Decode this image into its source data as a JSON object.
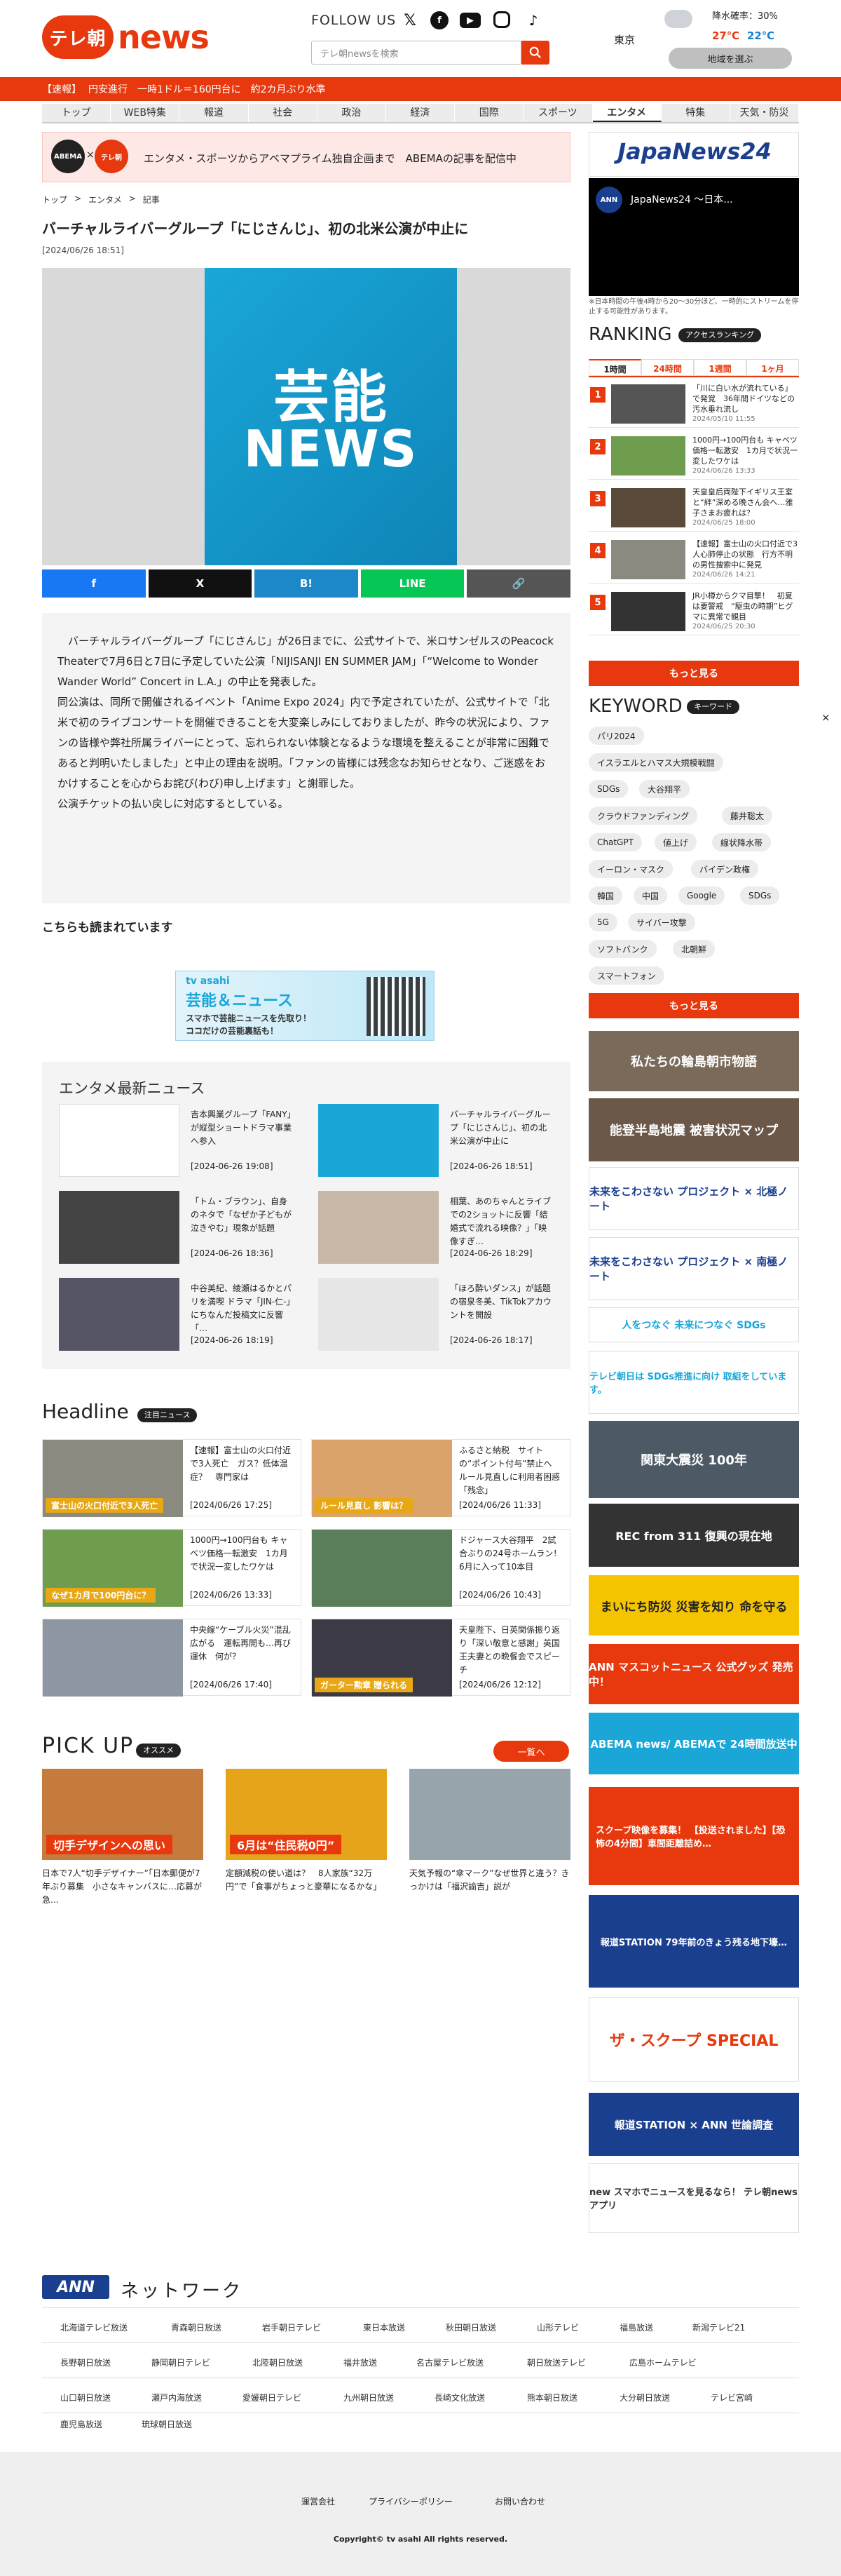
{
  "header": {
    "logo_pill": "テレ朝",
    "logo_text": "news",
    "follow": "FOLLOW US",
    "search_placeholder": "テレ朝newsを検索",
    "weather": {
      "location": "東京",
      "rain": "降水確率：30%",
      "high": "27℃",
      "low": "22℃",
      "area_button": "地域を選ぶ"
    }
  },
  "breaking": {
    "label": "【速報】",
    "text": "円安進行　一時1ドル＝160円台に　約2カ月ぶり水準"
  },
  "nav": [
    "トップ",
    "WEB特集",
    "報道",
    "社会",
    "政治",
    "経済",
    "国際",
    "スポーツ",
    "エンタメ",
    "特集",
    "天気・防災"
  ],
  "promo": {
    "logo1": "ABEMA",
    "x": "×",
    "logo2": "テレ朝",
    "text": "エンタメ・スポーツからアベマプライム独自企画まで　ABEMAの記事を配信中"
  },
  "breadcrumb": [
    "トップ",
    ">",
    "エンタメ",
    ">",
    "記事"
  ],
  "article": {
    "title": "バーチャルライバーグループ「にじさんじ」、初の北米公演が中止に",
    "date": "[2024/06/26 18:51]",
    "hero_line1": "芸能",
    "hero_line2": "NEWS",
    "share": [
      "f",
      "X",
      "B!",
      "LINE",
      "🔗"
    ],
    "body": [
      "　バーチャルライバーグループ「にじさんじ」が26日までに、公式サイトで、米ロサンゼルスのPeacock Theaterで7月6日と7日に予定していた公演「NIJISANJI EN SUMMER JAM」「“Welcome to Wonder Wander World” Concert in L.A.」の中止を発表した。",
      "同公演は、同所で開催されるイベント「Anime Expo 2024」内で予定されていたが、公式サイトで「北米で初のライブコンサートを開催できることを大変楽しみにしておりましたが、昨今の状況により、ファンの皆様や弊社所属ライバーにとって、忘れられない体験となるような環境を整えることが非常に困難であると判明いたしました」と中止の理由を説明。「ファンの皆様には残念なお知らせとなり、ご迷惑をおかけすることを心からお詫び(わび)申し上げます」と謝罪した。",
      "公演チケットの払い戻しに対応するとしている。"
    ]
  },
  "also": {
    "heading": "こちらも読まれています"
  },
  "banner": {
    "brand": "tv asahi",
    "title": "芸能＆ニュース",
    "sub1": "スマホで芸能ニュースを先取り！",
    "sub2": "ココだけの芸能裏話も！"
  },
  "ent": {
    "heading": "エンタメ最新ニュース",
    "items": [
      {
        "text": "吉本興業グループ「FANY」が縦型ショートドラマ事業へ参入",
        "date": "[2024-06-26 19:08]"
      },
      {
        "text": "バーチャルライバーグループ「にじさんじ」、初の北米公演が中止に",
        "date": "[2024-06-26 18:51]"
      },
      {
        "text": "「トム・ブラウン」、自身のネタで「なぜか子どもが泣きやむ」現象が話題",
        "date": "[2024-06-26 18:36]"
      },
      {
        "text": "相葉、あのちゃんとライブでの2ショットに反響「結婚式で流れる映像？」「映像すぎ…",
        "date": "[2024-06-26 18:29]"
      },
      {
        "text": "中谷美紀、綾瀬はるかとパリを満喫 ドラマ「JIN-仁-」にちなんだ投稿文に反響「…",
        "date": "[2024-06-26 18:19]"
      },
      {
        "text": "「ほろ酔いダンス」が話題の宿泉冬美、TikTokアカウントを開設",
        "date": "[2024-06-26 18:17]"
      }
    ]
  },
  "headline": {
    "title": "Headline",
    "badge": "注目ニュース",
    "items": [
      {
        "text": "【速報】富士山の火口付近で3人死亡　ガス？低体温症？　専門家は",
        "date": "[2024/06/26 17:25]",
        "caption": "富士山の火口付近で3人死亡"
      },
      {
        "text": "ふるさと納税　サイトの“ポイント付与”禁止へ　ルール見直しに利用者困惑「残念」",
        "date": "[2024/06/26 11:33]",
        "caption": "ルール見直し 影響は？"
      },
      {
        "text": "1000円→100円台も キャベツ価格一転激安　1カ月で状況一変したワケは",
        "date": "[2024/06/26 13:33]",
        "caption": "なぜ1カ月で100円台に？"
      },
      {
        "text": "ドジャース大谷翔平　2試合ぶりの24号ホームラン！ 6月に入って10本目",
        "date": "[2024/06/26 10:43]",
        "caption": ""
      },
      {
        "text": "中央線“ケーブル火災”混乱広がる　運転再開も…再び運休　何が？",
        "date": "[2024/06/26 17:40]",
        "caption": ""
      },
      {
        "text": "天皇陛下、日英関係振り返り「深い敬意と感謝」英国王夫妻との晩餐会でスピーチ",
        "date": "[2024/06/26 12:12]",
        "caption": "ガーター勲章 贈られる"
      }
    ]
  },
  "pickup": {
    "title": "PICK UP",
    "badge": "オススメ",
    "more": "一覧へ",
    "items": [
      {
        "text": "日本で7人“切手デザイナー”「日本郵便が7年ぶり募集　小さなキャンバスに…応募が急…",
        "caption": "切手デザインへの思い"
      },
      {
        "text": "定額減税の使い道は？　8人家族“32万円”で「食事がちょっと豪華になるかな」",
        "caption": "6月は“住民税0円”"
      },
      {
        "text": "天気予報の“傘マーク”なぜ世界と違う？きっかけは「福沢諭吉」説が",
        "caption": ""
      }
    ]
  },
  "side": {
    "jn_logo": "JapaNews24",
    "jn_video_title": "JapaNews24 〜日本...",
    "jn_note": "※日本時間の午後4時から20〜30分ほど、一時的にストリームを停止する可能性があります。",
    "ranking_title": "RANKING",
    "ranking_badge": "アクセスランキング",
    "ranking_tabs": [
      "1時間",
      "24時間",
      "1週間",
      "1ヶ月"
    ],
    "ranking_items": [
      {
        "num": "1",
        "text": "「川に白い水が流れている」で発覚　36年間ドイツなどの汚水垂れ流し",
        "date": "2024/05/10 11:55"
      },
      {
        "num": "2",
        "text": "1000円→100円台も キャベツ価格一転激安　1カ月で状況一変したワケは",
        "date": "2024/06/26 13:33"
      },
      {
        "num": "3",
        "text": "天皇皇后両陛下イギリス王室と“絆”深める晩さん会へ…雅子さまお疲れは？",
        "date": "2024/06/25 18:00"
      },
      {
        "num": "4",
        "text": "【速報】富士山の火口付近で3人心肺停止の状態　行方不明の男性捜索中に発見",
        "date": "2024/06/26 14:21"
      },
      {
        "num": "5",
        "text": "JR小樽からクマ目撃！　初夏は要警戒　“駆虫の時期”ヒグマに異常で親目",
        "date": "2024/06/25 20:30"
      }
    ],
    "more": "もっと見る",
    "keyword_title": "KEYWORD",
    "keyword_badge": "キーワード",
    "keywords": [
      "パリ2024",
      "イスラエルとハマス大規模戦闘",
      "SDGs",
      "大谷翔平",
      "クラウドファンディング",
      "藤井聡太",
      "ChatGPT",
      "値上げ",
      "線状降水帯",
      "イーロン・マスク",
      "バイデン政権",
      "韓国",
      "中国",
      "Google",
      "SDGs",
      "5G",
      "サイバー攻撃",
      "ソフトバンク",
      "北朝鮮",
      "スマートフォン"
    ],
    "keyword_more": "もっと見る",
    "banners": [
      "私たちの輪島朝市物語",
      "能登半島地震 被害状況マップ",
      "未来をこわさない プロジェクト × 北極ノート",
      "未来をこわさない プロジェクト × 南極ノート",
      "人をつなぐ 未来につなぐ SDGs",
      "テレビ朝日は SDGs推進に向け 取組をしています。",
      "関東大震災 100年",
      "REC from 311 復興の現在地",
      "まいにち防災 災害を知り 命を守る",
      "ANN マスコットニュース 公式グッズ 発売中！",
      "ABEMA news/ ABEMAで 24時間放送中",
      "スクープ映像を募集！ 【投送されました】【恐怖の4分間】車間距離詰め…",
      "報道STATION 79年前のきょう残る地下壕…",
      "ザ・スクープ SPECIAL",
      "報道STATION × ANN 世論調査",
      "new スマホでニュースを見るなら！ テレ朝newsアプリ"
    ]
  },
  "network": {
    "logo": "ANN",
    "title": "ネットワーク",
    "rows": [
      [
        "北海道テレビ放送",
        "青森朝日放送",
        "岩手朝日テレビ",
        "東日本放送",
        "秋田朝日放送",
        "山形テレビ",
        "福島放送",
        "新潟テレビ21"
      ],
      [
        "長野朝日放送",
        "静岡朝日テレビ",
        "北陸朝日放送",
        "福井放送",
        "名古屋テレビ放送",
        "朝日放送テレビ",
        "広島ホームテレビ"
      ],
      [
        "山口朝日放送",
        "瀬戸内海放送",
        "愛媛朝日テレビ",
        "九州朝日放送",
        "長崎文化放送",
        "熊本朝日放送",
        "大分朝日放送",
        "テレビ宮崎"
      ],
      [
        "鹿児島放送",
        "琉球朝日放送"
      ]
    ]
  },
  "footer": {
    "links": [
      "運営会社",
      "プライバシーポリシー",
      "お問い合わせ"
    ],
    "copyright": "Copyright© tv asahi All rights reserved."
  }
}
